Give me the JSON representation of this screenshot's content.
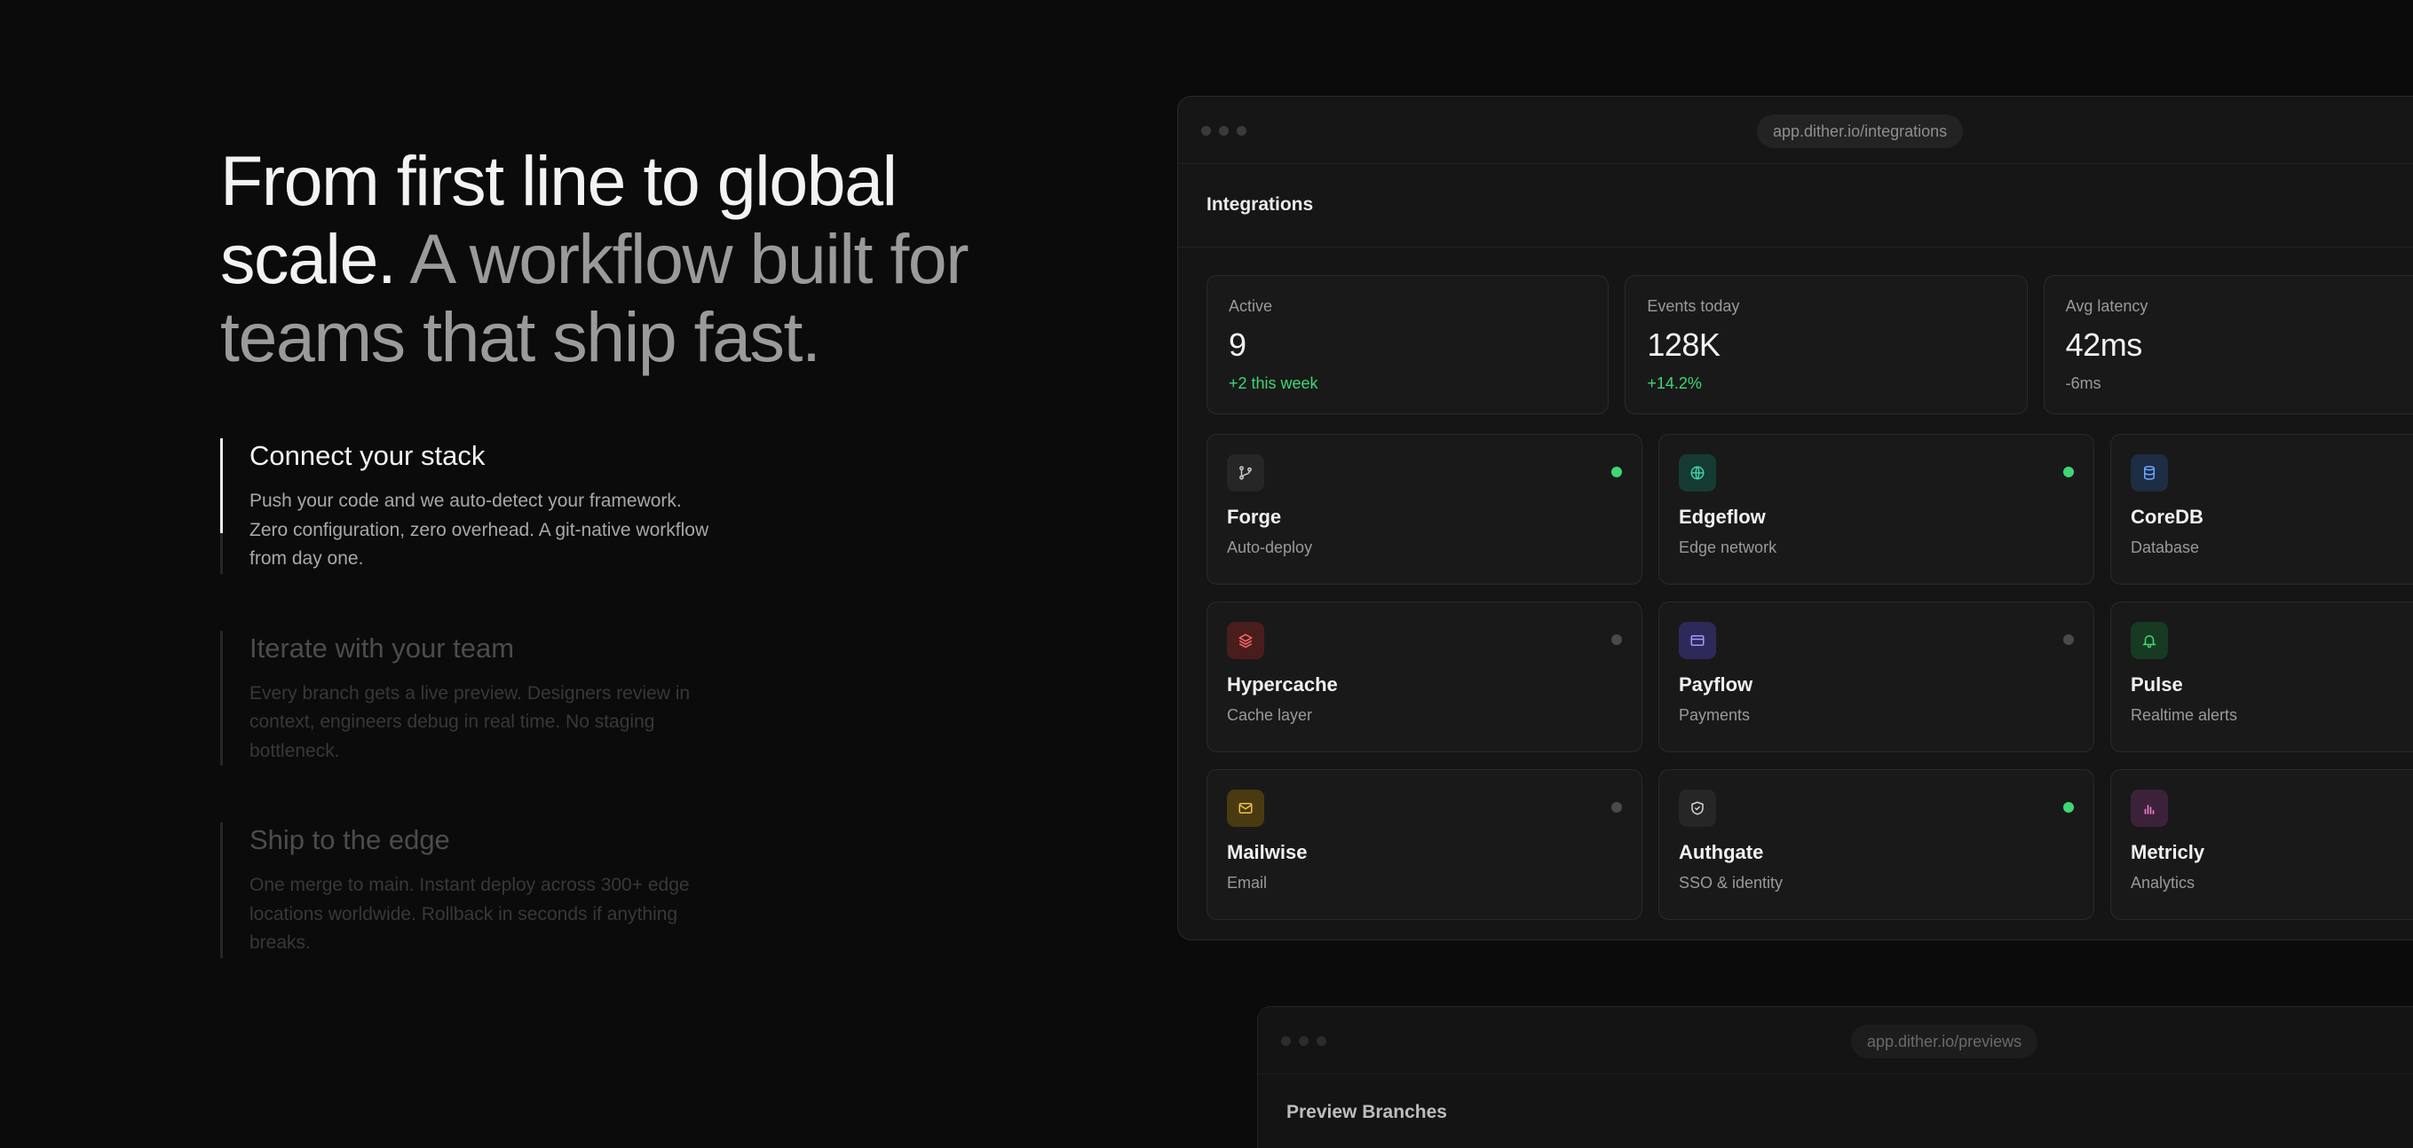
{
  "hero": {
    "headline_strong": "From first line to global scale.",
    "headline_muted": "A workflow built for teams that ship fast."
  },
  "features": [
    {
      "title": "Connect your stack",
      "description": "Push your code and we auto-detect your framework. Zero configuration, zero overhead. A git-native workflow from day one."
    },
    {
      "title": "Iterate with your team",
      "description": "Every branch gets a live preview. Designers review in context, engineers debug in real time. No staging bottleneck."
    },
    {
      "title": "Ship to the edge",
      "description": "One merge to main. Instant deploy across 300+ edge locations worldwide. Rollback in seconds if anything breaks."
    }
  ],
  "browser": {
    "url": "app.dither.io/integrations",
    "title": "Integrations",
    "stats": [
      {
        "label": "Active",
        "value": "9",
        "delta": "+2 this week"
      },
      {
        "label": "Events today",
        "value": "128K",
        "delta": "+14.2%"
      },
      {
        "label": "Avg latency",
        "value": "42ms",
        "delta": "-6ms"
      }
    ],
    "integrations": [
      {
        "name": "Forge",
        "subtitle": "Auto-deploy",
        "status": "active",
        "icon": "git-branch-icon"
      },
      {
        "name": "Edgeflow",
        "subtitle": "Edge network",
        "status": "active",
        "icon": "globe-icon"
      },
      {
        "name": "CoreDB",
        "subtitle": "Database",
        "status": "none",
        "icon": "database-icon"
      },
      {
        "name": "Hypercache",
        "subtitle": "Cache layer",
        "status": "inactive",
        "icon": "layers-icon"
      },
      {
        "name": "Payflow",
        "subtitle": "Payments",
        "status": "inactive",
        "icon": "credit-card-icon"
      },
      {
        "name": "Pulse",
        "subtitle": "Realtime alerts",
        "status": "none",
        "icon": "bell-icon"
      },
      {
        "name": "Mailwise",
        "subtitle": "Email",
        "status": "inactive",
        "icon": "mail-icon"
      },
      {
        "name": "Authgate",
        "subtitle": "SSO & identity",
        "status": "active",
        "icon": "shield-icon"
      },
      {
        "name": "Metricly",
        "subtitle": "Analytics",
        "status": "none",
        "icon": "bar-chart-icon"
      }
    ]
  },
  "browser2": {
    "url": "app.dither.io/previews",
    "title": "Preview Branches"
  },
  "colors": {
    "background": "#0b0b0b",
    "status_active": "#3fd775",
    "status_inactive": "#4a4a4a",
    "delta_positive": "#3fd775"
  }
}
